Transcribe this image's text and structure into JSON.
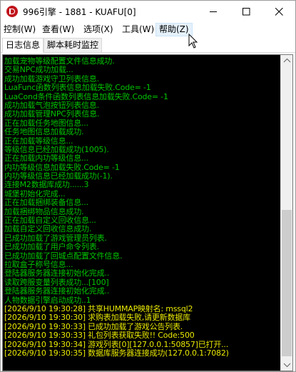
{
  "window": {
    "title": "996引擎 - 1881 - KUAFU[0]"
  },
  "menu": {
    "items": [
      {
        "label": "控制(W)"
      },
      {
        "label": "查看(W)"
      },
      {
        "label": "选项(X)"
      },
      {
        "label": "工具(W)"
      },
      {
        "label": "帮助(Z)"
      }
    ]
  },
  "tabs": [
    {
      "label": "日志信息",
      "active": true
    },
    {
      "label": "脚本耗时监控",
      "active": false
    }
  ],
  "log": {
    "lines": [
      {
        "text": "加载宠物等级配置文件信息成功.",
        "color": "green"
      },
      {
        "text": "交易NPC成功加载...",
        "color": "green"
      },
      {
        "text": "成功加载游戏守卫列表信息.",
        "color": "green"
      },
      {
        "text": "LuaFunc函数列表信息加载失败.Code= -1",
        "color": "green"
      },
      {
        "text": "LuaCond条件函数列表信息加载失败.Code= -1",
        "color": "green"
      },
      {
        "text": "成功加载气泡按钮列表信息.",
        "color": "green"
      },
      {
        "text": "成功加载管理NPC列表信息.",
        "color": "green"
      },
      {
        "text": "正在加载任务地图信息...",
        "color": "green"
      },
      {
        "text": "任务地图信息加载成功.",
        "color": "green"
      },
      {
        "text": "正在加载等级信息...",
        "color": "green"
      },
      {
        "text": "等级信息已经加载成功(1005).",
        "color": "green"
      },
      {
        "text": "正在加载内功等级信息...",
        "color": "green"
      },
      {
        "text": "内功等级信息加载失败.Code= -1",
        "color": "green"
      },
      {
        "text": "内功等级信息已经加载成功(-1).",
        "color": "green"
      },
      {
        "text": "连接M2数据库成功......3",
        "color": "green"
      },
      {
        "text": "城堡初始化完成...",
        "color": "green"
      },
      {
        "text": "正在加载捆绑装备信息...",
        "color": "green"
      },
      {
        "text": "加载捆绑物品信息成功.",
        "color": "green"
      },
      {
        "text": "正在加载自定义回收信息...",
        "color": "green"
      },
      {
        "text": "加载自定义回收信息成功.",
        "color": "green"
      },
      {
        "text": "已成功加载了游戏管理员列表.",
        "color": "green"
      },
      {
        "text": "已成功加载了用户命令列表.",
        "color": "green"
      },
      {
        "text": "已成功加载了回城点配置文件信息.",
        "color": "green"
      },
      {
        "text": "拉取盒子称号信息...",
        "color": "green"
      },
      {
        "text": "登陆器服务器连接初始化完成..",
        "color": "green"
      },
      {
        "text": "读取跨服变量列表成功...[100]",
        "color": "green"
      },
      {
        "text": "登陆器服务器连接初始化完成..",
        "color": "green"
      },
      {
        "text": "人物数据引擎启动成功..1",
        "color": "green"
      },
      {
        "text": "[2026/9/10 19:30:28] 共享HUMMAP映射名: mssql2",
        "color": "yellow"
      },
      {
        "text": "[2026/9/10 19:30:30] 求购表加载失败,请更新数据库",
        "color": "yellow"
      },
      {
        "text": "[2026/9/10 19:30:33] 已成功加载了游戏公告列表.",
        "color": "yellow"
      },
      {
        "text": "[2026/9/10 19:30:33] 礼包列表获取失败!! Code:500",
        "color": "yellow"
      },
      {
        "text": "[2026/9/10 19:30:34] 游戏列表[0][127.0.0.1:50857]已打开...",
        "color": "yellow"
      },
      {
        "text": "[2026/9/10 19:30:35] 数据库服务器连接成功(127.0.0.1:7082)",
        "color": "yellow"
      }
    ]
  }
}
